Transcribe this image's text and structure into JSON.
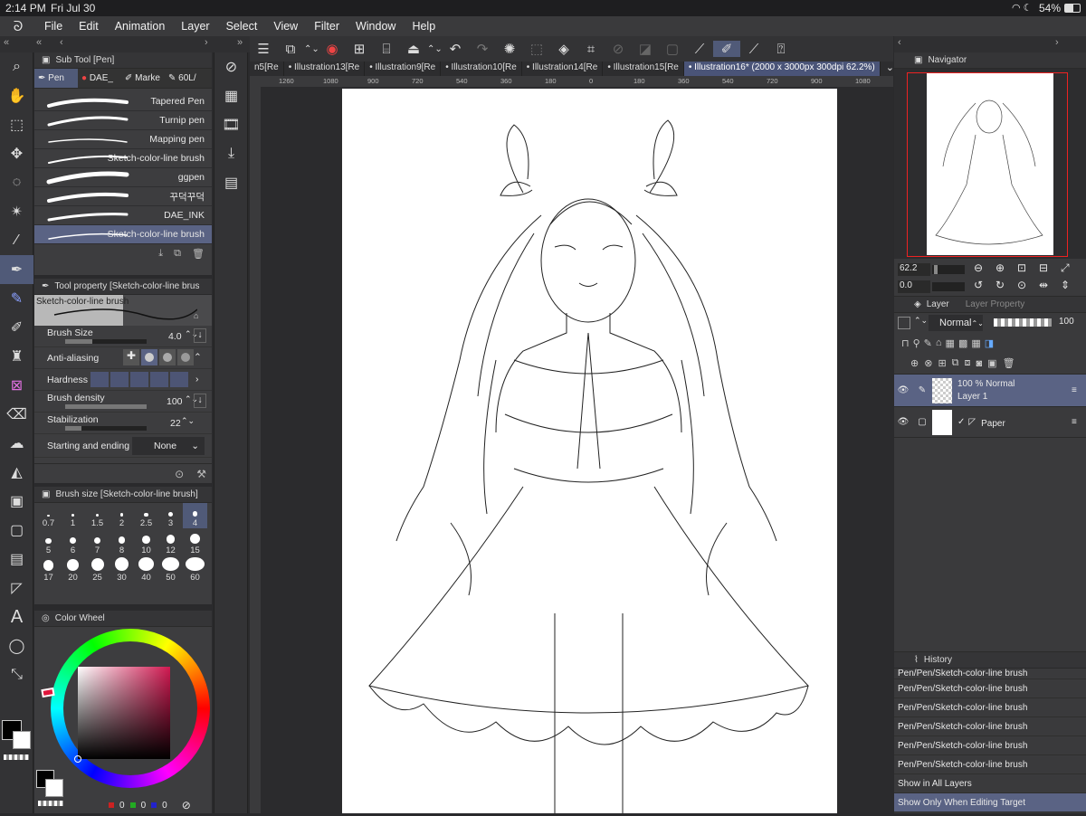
{
  "status": {
    "time": "2:14 PM",
    "date": "Fri Jul 30",
    "battery": "54%"
  },
  "menu": [
    "File",
    "Edit",
    "Animation",
    "Layer",
    "Select",
    "View",
    "Filter",
    "Window",
    "Help"
  ],
  "subtool": {
    "title": "Sub Tool [Pen]",
    "groups": [
      "Pen",
      "DAE_",
      "Marke",
      "60L/"
    ],
    "brushes": [
      "Tapered Pen",
      "Turnip pen",
      "Mapping pen",
      "Sketch-color-line brush",
      "ggpen",
      "꾸덕꾸덕",
      "DAE_INK",
      "Sketch-color-line brush"
    ]
  },
  "toolprop": {
    "title": "Tool property [Sketch-color-line brus",
    "brush_name": "Sketch-color-line brush",
    "rows": [
      {
        "label": "Brush Size",
        "value": "4.0"
      },
      {
        "label": "Anti-aliasing",
        "value": ""
      },
      {
        "label": "Hardness",
        "value": ""
      },
      {
        "label": "Brush density",
        "value": "100"
      },
      {
        "label": "Stabilization",
        "value": "22"
      },
      {
        "label": "Starting and ending",
        "value": "None"
      }
    ]
  },
  "brushsize": {
    "title": "Brush size [Sketch-color-line brush]",
    "sizes": [
      "0.7",
      "1",
      "1.5",
      "2",
      "2.5",
      "3",
      "4",
      "5",
      "6",
      "7",
      "8",
      "10",
      "12",
      "15",
      "17",
      "20",
      "25",
      "30",
      "40",
      "50",
      "60"
    ],
    "selected": "4"
  },
  "colorwheel": {
    "title": "Color Wheel",
    "hue": "#c8184a",
    "r": "0",
    "g": "0",
    "b": "0"
  },
  "tabs": [
    "n5[Re",
    "Illustration13[Re",
    "Illustration9[Re",
    "Illustration10[Re",
    "Illustration14[Re",
    "Illustration15[Re",
    "Illustration16* (2000 x 3000px 300dpi 62.2%)"
  ],
  "ruler": [
    "1260",
    "1080",
    "900",
    "720",
    "540",
    "360",
    "180",
    "0",
    "180",
    "360",
    "540",
    "720",
    "900",
    "1080"
  ],
  "navigator": {
    "title": "Navigator",
    "zoom": "62.2",
    "rotate": "0.0"
  },
  "layer": {
    "title": "Layer",
    "title2": "Layer Property",
    "blend": "Normal",
    "opacity": "100",
    "layers": [
      {
        "line1": "100 %  Normal",
        "line2": "Layer 1"
      },
      {
        "line1": "",
        "line2": "Paper"
      }
    ]
  },
  "history": {
    "title": "History",
    "items": [
      "Pen/Pen/Sketch-color-line brush",
      "Pen/Pen/Sketch-color-line brush",
      "Pen/Pen/Sketch-color-line brush",
      "Pen/Pen/Sketch-color-line brush",
      "Pen/Pen/Sketch-color-line brush",
      "Pen/Pen/Sketch-color-line brush"
    ],
    "opt1": "Show in All Layers",
    "opt2": "Show Only When Editing Target"
  }
}
